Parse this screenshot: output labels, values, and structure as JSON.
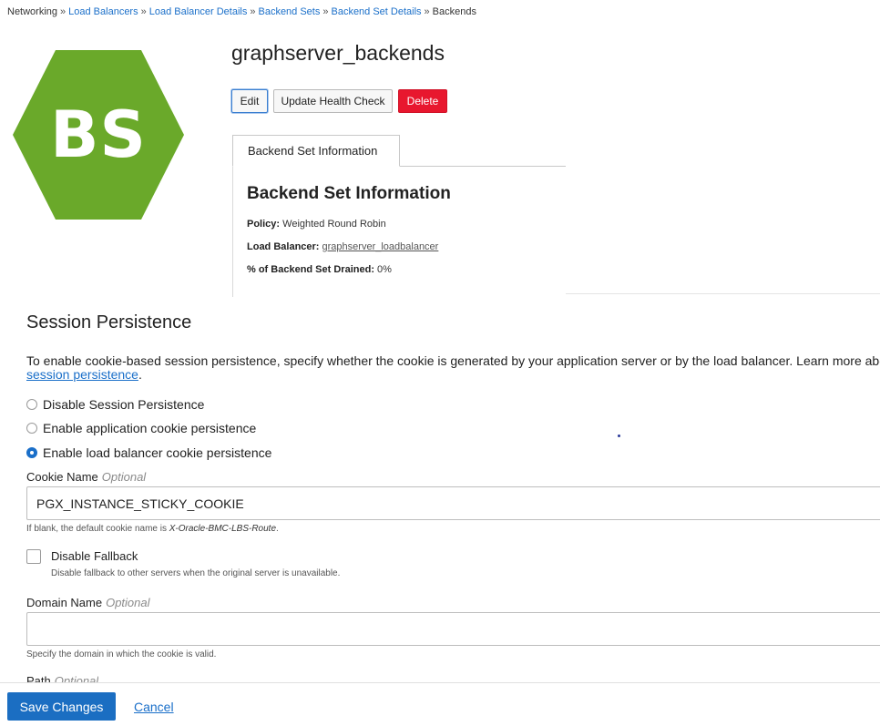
{
  "breadcrumb": {
    "items": [
      "Networking",
      "Load Balancers",
      "Load Balancer Details",
      "Backend Sets",
      "Backend Set Details",
      "Backends"
    ],
    "separator": "»"
  },
  "resource": {
    "badge": "BS",
    "badge_color": "#6aa92a",
    "title": "graphserver_backends"
  },
  "actions": {
    "edit": "Edit",
    "update_health_check": "Update Health Check",
    "delete": "Delete"
  },
  "tabs": [
    "Backend Set Information"
  ],
  "info": {
    "heading": "Backend Set Information",
    "policy_label": "Policy:",
    "policy_value": "Weighted Round Robin",
    "lb_label": "Load Balancer:",
    "lb_value": "graphserver_loadbalancer",
    "drained_label": "% of Backend Set Drained:",
    "drained_value": "0%"
  },
  "session": {
    "title": "Session Persistence",
    "desc_text": "To enable cookie-based session persistence, specify whether the cookie is generated by your application server or by the load balancer. Learn more about ",
    "desc_link": "session persistence",
    "desc_end": ".",
    "options": [
      {
        "label": "Disable Session Persistence",
        "selected": false
      },
      {
        "label": "Enable application cookie persistence",
        "selected": false
      },
      {
        "label": "Enable load balancer cookie persistence",
        "selected": true
      }
    ],
    "cookie_label": "Cookie Name",
    "optional": "Optional",
    "cookie_value": "PGX_INSTANCE_STICKY_COOKIE",
    "cookie_hint_prefix": "If blank, the default cookie name is ",
    "cookie_hint_value": "X-Oracle-BMC-LBS-Route",
    "cookie_hint_end": ".",
    "fallback_label": "Disable Fallback",
    "fallback_hint": "Disable fallback to other servers when the original server is unavailable.",
    "domain_label": "Domain Name",
    "domain_value": "",
    "domain_hint": "Specify the domain in which the cookie is valid.",
    "path_label": "Path"
  },
  "footer": {
    "save": "Save Changes",
    "cancel": "Cancel"
  }
}
